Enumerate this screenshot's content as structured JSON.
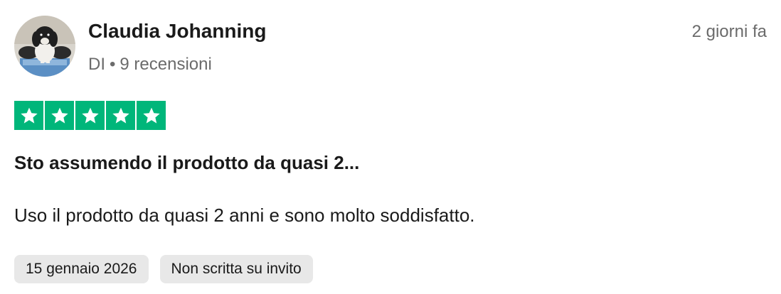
{
  "reviewer": {
    "name": "Claudia Johanning",
    "country": "DI",
    "separator": "•",
    "reviews_count": "9 recensioni"
  },
  "review": {
    "posted_ago": "2 giorni fa",
    "rating": 5,
    "rating_max": 5,
    "title": "Sto assumendo il prodotto da quasi 2...",
    "body": "Uso il prodotto da quasi 2 anni e sono molto soddisfatto.",
    "tags": [
      {
        "label": "15 gennaio 2026"
      },
      {
        "label": "Non scritta su invito"
      }
    ]
  },
  "colors": {
    "star_bg": "#00b67a",
    "star_fg": "#ffffff",
    "tag_bg": "#e8e8e8",
    "muted_text": "#6b6b6b"
  },
  "icons": {
    "avatar": "dog-photo-avatar",
    "star": "star-icon"
  }
}
